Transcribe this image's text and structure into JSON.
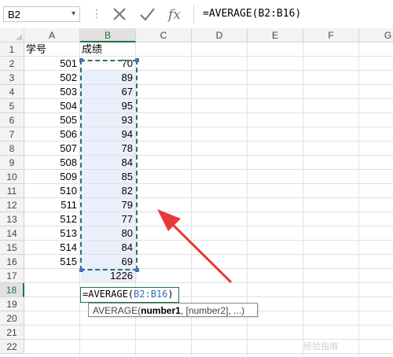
{
  "formula_bar": {
    "name_box": "B2",
    "name_box_arrow": "▾",
    "dots": "⋮",
    "cancel_icon": "cancel-icon",
    "enter_icon": "enter-icon",
    "fx_label": "fx",
    "formula": "=AVERAGE(B2:B16)"
  },
  "columns": [
    "A",
    "B",
    "C",
    "D",
    "E",
    "F",
    "G"
  ],
  "rows": [
    "1",
    "2",
    "3",
    "4",
    "5",
    "6",
    "7",
    "8",
    "9",
    "10",
    "11",
    "12",
    "13",
    "14",
    "15",
    "16",
    "17",
    "18",
    "19",
    "20",
    "21",
    "22"
  ],
  "selected_column": "B",
  "selected_row": "18",
  "header_row": {
    "a": "学号",
    "b": "成绩"
  },
  "data_rows": [
    {
      "a": "501",
      "b": "70"
    },
    {
      "a": "502",
      "b": "89"
    },
    {
      "a": "503",
      "b": "67"
    },
    {
      "a": "504",
      "b": "95"
    },
    {
      "a": "505",
      "b": "93"
    },
    {
      "a": "506",
      "b": "94"
    },
    {
      "a": "507",
      "b": "78"
    },
    {
      "a": "508",
      "b": "84"
    },
    {
      "a": "509",
      "b": "85"
    },
    {
      "a": "510",
      "b": "82"
    },
    {
      "a": "511",
      "b": "79"
    },
    {
      "a": "512",
      "b": "77"
    },
    {
      "a": "513",
      "b": "80"
    },
    {
      "a": "514",
      "b": "84"
    },
    {
      "a": "515",
      "b": "69"
    }
  ],
  "total_value": "1226",
  "edit_cell": {
    "prefix": "=AVERAGE(",
    "range": "B2:B16",
    "suffix": ")"
  },
  "tooltip": {
    "func": "AVERAGE(",
    "arg1": "number1",
    "rest": ", [number2], ...)"
  },
  "annotation_color": "#e8383d",
  "selection_color": "#2f6e79",
  "watermark": "经验指南"
}
